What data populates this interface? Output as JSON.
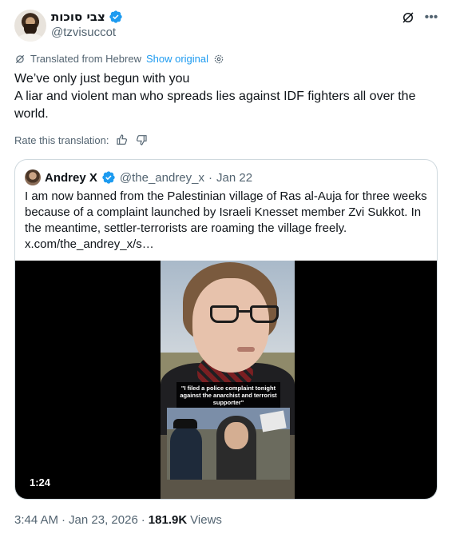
{
  "author": {
    "display_name": "צבי סוכות",
    "handle": "@tzvisuccot"
  },
  "translation": {
    "label": "Translated from Hebrew",
    "show_original": "Show original"
  },
  "tweet": {
    "lines": [
      "We’ve only just begun with you",
      "A liar and violent man who spreads lies against IDF fighters all over the world."
    ]
  },
  "rate": {
    "label": "Rate this translation:"
  },
  "quote": {
    "name": "Andrey X",
    "handle": "@the_andrey_x",
    "separator": "·",
    "date": "Jan 22",
    "text": "I am now banned from the Palestinian village of Ras al-Auja for three weeks because of a complaint launched by Israeli Knesset member Zvi Sukkot. In the meantime, settler-terrorists are roaming the village freely. x.com/the_andrey_x/s…",
    "video": {
      "caption": "\"I filed a police complaint tonight against the anarchist and terrorist supporter\"",
      "duration": "1:24"
    }
  },
  "footer": {
    "time": "3:44 AM",
    "sep1": "·",
    "date": "Jan 23, 2026",
    "sep2": "·",
    "views": "181.9K",
    "views_label": "Views"
  },
  "colors": {
    "accent": "#1d9bf0",
    "secondary_text": "#536471",
    "border": "#cfd9de"
  },
  "icons": [
    "verified-badge-icon",
    "grok-icon",
    "more-icon",
    "translate-icon",
    "settings-icon",
    "thumbs-up-icon",
    "thumbs-down-icon"
  ]
}
